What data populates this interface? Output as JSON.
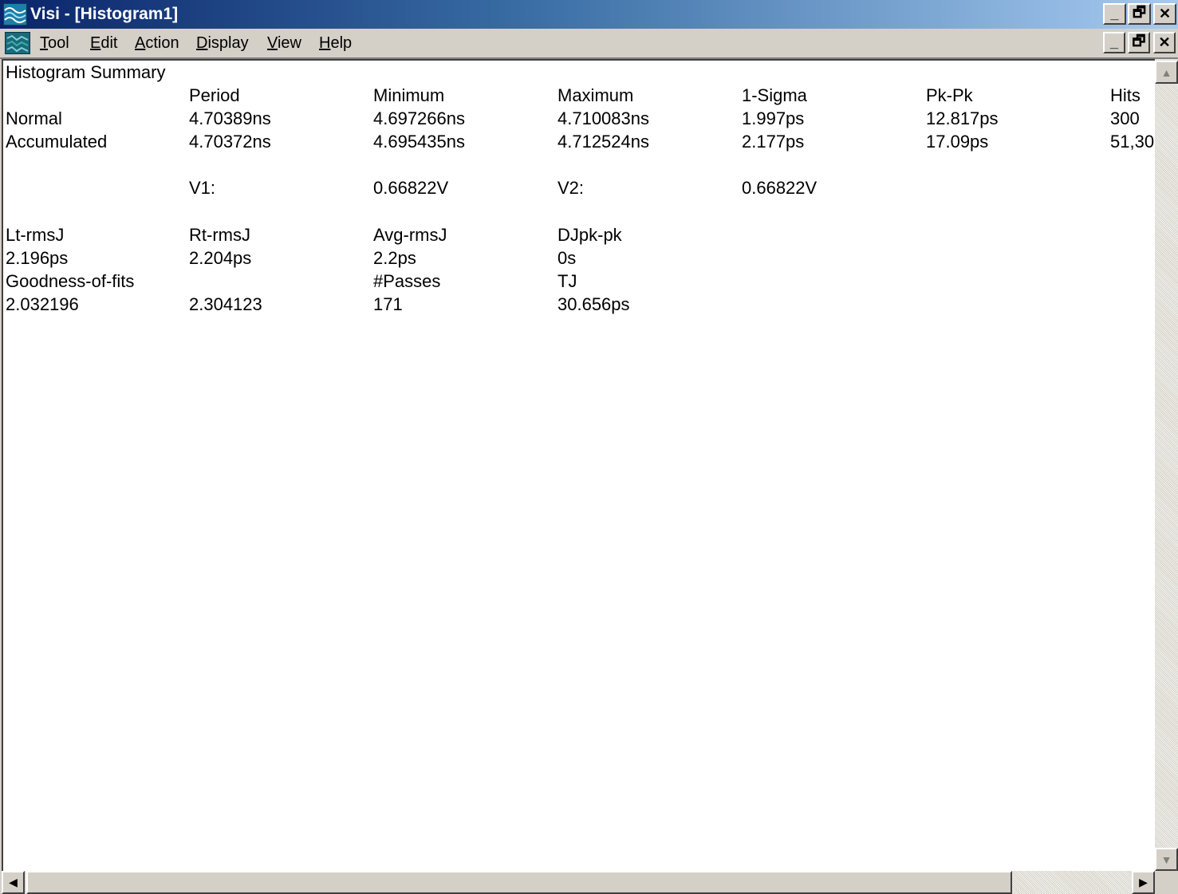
{
  "window": {
    "title": "Visi - [Histogram1]",
    "caption_buttons": {
      "minimize": "_",
      "restore": "🗗",
      "close": "✕"
    }
  },
  "menu": {
    "items": [
      {
        "label_accel": "T",
        "label_rest": "ool"
      },
      {
        "label_accel": "E",
        "label_rest": "dit"
      },
      {
        "label_accel": "A",
        "label_rest": "ction"
      },
      {
        "label_accel": "D",
        "label_rest": "isplay"
      },
      {
        "label_accel": "V",
        "label_rest": "iew"
      },
      {
        "label_accel": "H",
        "label_rest": "elp"
      }
    ],
    "mdi_buttons": {
      "minimize": "_",
      "restore": "🗗",
      "close": "✕"
    }
  },
  "summary": {
    "title": "Histogram Summary",
    "headers": [
      "Period",
      "Minimum",
      "Maximum",
      "1-Sigma",
      "Pk-Pk",
      "Hits"
    ],
    "rows": [
      {
        "label": "Normal",
        "values": [
          "4.70389ns",
          "4.697266ns",
          "4.710083ns",
          "1.997ps",
          "12.817ps",
          "300"
        ]
      },
      {
        "label": "Accumulated",
        "values": [
          "4.70372ns",
          "4.695435ns",
          "4.712524ns",
          "2.177ps",
          "17.09ps",
          "51,30"
        ]
      }
    ],
    "voltages": {
      "v1_label": "V1:",
      "v1_value": "0.66822V",
      "v2_label": "V2:",
      "v2_value": "0.66822V"
    },
    "jitter_headers": [
      "Lt-rmsJ",
      "Rt-rmsJ",
      "Avg-rmsJ",
      "DJpk-pk"
    ],
    "jitter_values": [
      "2.196ps",
      "2.204ps",
      "2.2ps",
      "0s"
    ],
    "fit_headers": [
      "Goodness-of-fits",
      "",
      "#Passes",
      "TJ"
    ],
    "fit_values": [
      "2.032196",
      "2.304123",
      "171",
      "30.656ps"
    ]
  },
  "scrollbars": {
    "up": "▲",
    "down": "▼",
    "left": "◀",
    "right": "▶"
  }
}
